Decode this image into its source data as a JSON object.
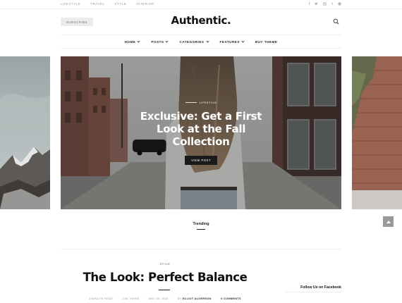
{
  "topbar": {
    "nav": [
      "Lifestyle",
      "Travel",
      "Style",
      "Interior"
    ],
    "social_icons": [
      "facebook-icon",
      "twitter-icon",
      "instagram-icon",
      "tumblr-icon",
      "pinterest-icon"
    ]
  },
  "header": {
    "subscribe_label": "Subscribe",
    "logo": "Authentic."
  },
  "mainnav": [
    {
      "label": "Home",
      "has_dropdown": true
    },
    {
      "label": "Posts",
      "has_dropdown": true
    },
    {
      "label": "Categories",
      "has_dropdown": true
    },
    {
      "label": "Features",
      "has_dropdown": true
    },
    {
      "label": "Buy Theme",
      "has_dropdown": false
    }
  ],
  "hero": {
    "category": "Lifestyle",
    "title": "Exclusive: Get a First Look at the Fall Collection",
    "button_label": "View Post"
  },
  "trending": {
    "label": "Trending"
  },
  "featured_post": {
    "category": "Style",
    "title": "The Look: Perfect Balance",
    "read_time": "3 minute read",
    "views": "3.6K views",
    "date": "May 20, 2016",
    "author_prefix": "by",
    "author": "Elliot Alderson",
    "comments": "0 Comments"
  },
  "sidebar": {
    "facebook_title": "Follow Us on Facebook"
  },
  "colors": {
    "accent": "#1a1a1a",
    "subscribe_bg": "#ebebeb",
    "scroll_top_bg": "#999999"
  }
}
